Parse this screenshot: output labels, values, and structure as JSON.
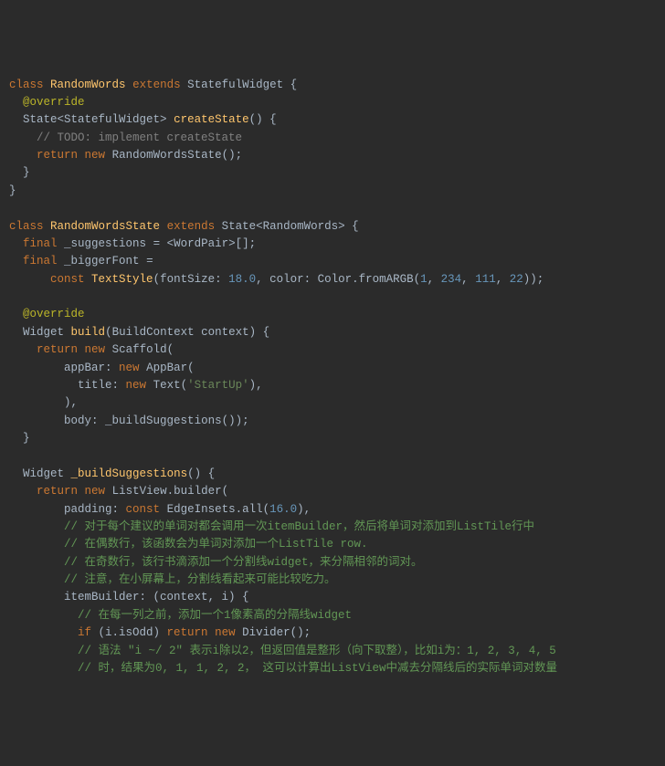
{
  "code": {
    "l1_kw_class": "class",
    "l1_name": "RandomWords",
    "l1_kw_ext": "extends",
    "l1_base": "StatefulWidget",
    "l1_brace": " {",
    "l2_anno": "@override",
    "l3_ret": "State<StatefulWidget>",
    "l3_method": "createState",
    "l3_tail": "() {",
    "l4_comment": "// TODO: implement createState",
    "l5_ret": "return",
    "l5_new": "new",
    "l5_call": "RandomWordsState();",
    "l6_close": "}",
    "l7_close": "}",
    "l9_kw_class": "class",
    "l9_name": "RandomWordsState",
    "l9_kw_ext": "extends",
    "l9_base": "State<RandomWords>",
    "l9_brace": " {",
    "l10_final": "final",
    "l10_var": "_suggestions",
    "l10_eq": " = <WordPair>[];",
    "l11_final": "final",
    "l11_var": "_biggerFont",
    "l11_eq": " =",
    "l12_const": "const",
    "l12_ts": "TextStyle",
    "l12_open": "(fontSize: ",
    "l12_n1": "18.0",
    "l12_mid": ", color: Color.fromARGB(",
    "l12_a": "1",
    "l12_c2": ", ",
    "l12_r": "234",
    "l12_c3": ", ",
    "l12_g": "111",
    "l12_c4": ", ",
    "l12_b": "22",
    "l12_end": "));",
    "l14_anno": "@override",
    "l15_ret": "Widget",
    "l15_method": "build",
    "l15_params": "(BuildContext context) {",
    "l16_ret": "return",
    "l16_new": "new",
    "l16_call": "Scaffold(",
    "l17_prop": "appBar:",
    "l17_new": "new",
    "l17_call": "AppBar(",
    "l18_prop": "title:",
    "l18_new": "new",
    "l18_text": "Text(",
    "l18_str": "'StartUp'",
    "l18_end": "),",
    "l19_close": "),",
    "l20_prop": "body:",
    "l20_call": "_buildSuggestions());",
    "l21_close": "}",
    "l23_ret": "Widget",
    "l23_method": "_buildSuggestions",
    "l23_tail": "() {",
    "l24_ret": "return",
    "l24_new": "new",
    "l24_call": "ListView.builder(",
    "l25_prop": "padding:",
    "l25_const": "const",
    "l25_call": "EdgeInsets.all(",
    "l25_num": "16.0",
    "l25_end": "),",
    "l26_comment": "// 对于每个建议的单词对都会调用一次itemBuilder，然后将单词对添加到ListTile行中",
    "l27_comment": "// 在偶数行，该函数会为单词对添加一个ListTile row.",
    "l28_comment": "// 在奇数行，该行书滴添加一个分割线widget，来分隔相邻的词对。",
    "l29_comment": "// 注意，在小屏幕上，分割线看起来可能比较吃力。",
    "l30_prop": "itemBuilder:",
    "l30_rest": " (context, i) {",
    "l31_comment": "// 在每一列之前，添加一个1像素高的分隔线widget",
    "l32_if": "if",
    "l32_cond": " (i.isOdd) ",
    "l32_ret": "return",
    "l32_new": "new",
    "l32_call": "Divider();",
    "l33_comment": "// 语法 \"i ~/ 2\" 表示i除以2，但返回值是整形（向下取整），比如i为：1, 2, 3, 4, 5",
    "l34_comment": "// 时，结果为0, 1, 1, 2, 2， 这可以计算出ListView中减去分隔线后的实际单词对数量"
  }
}
